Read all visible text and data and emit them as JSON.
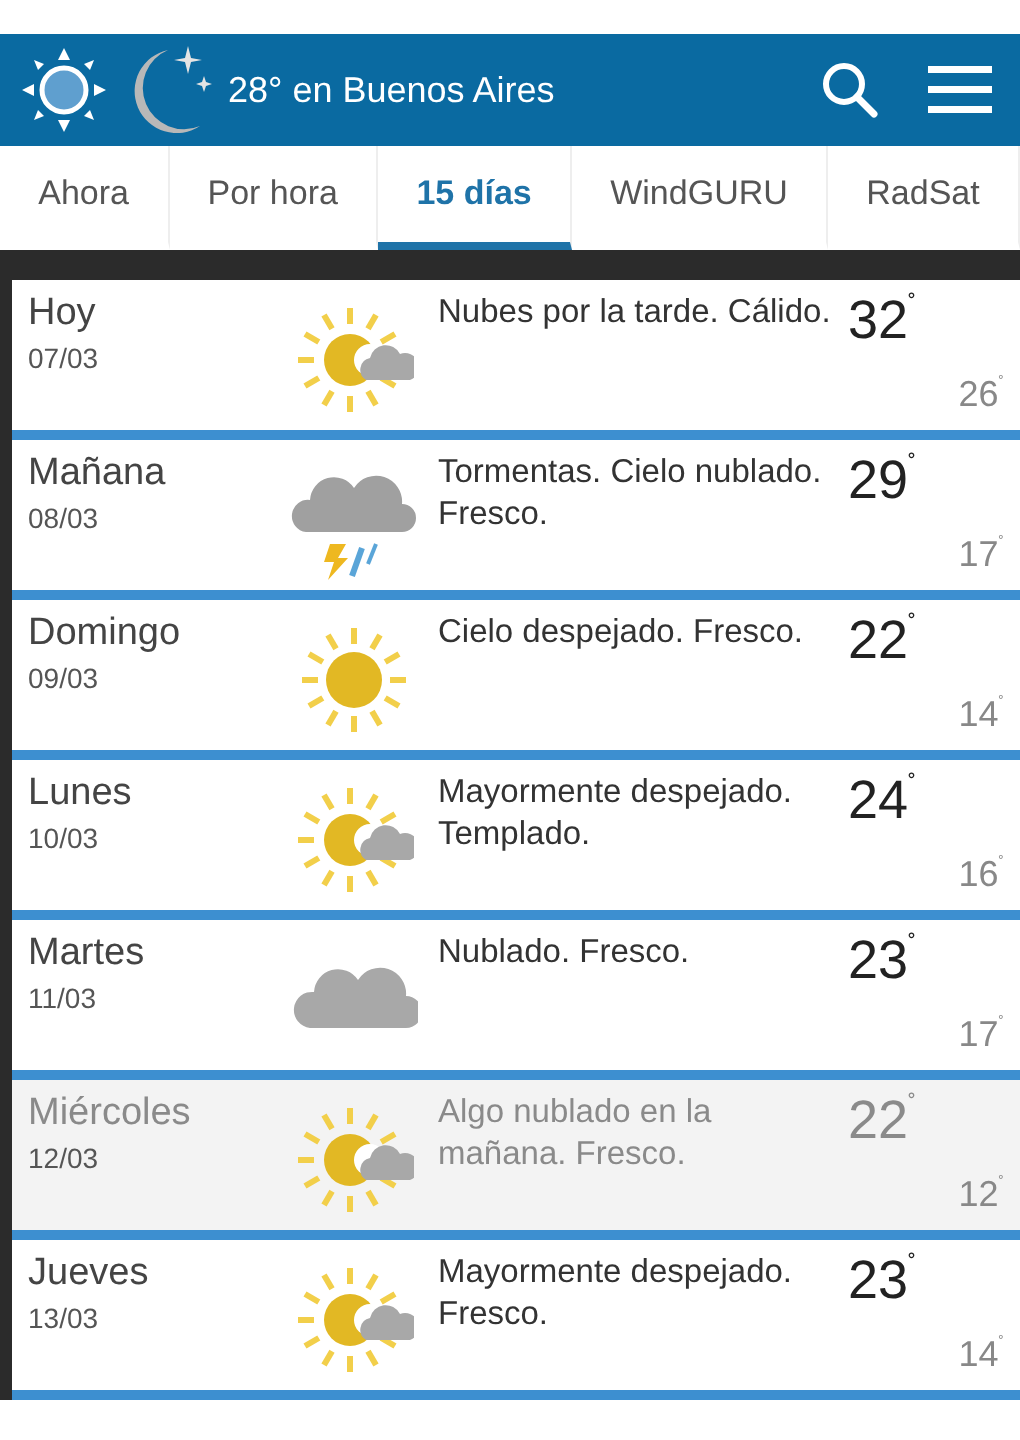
{
  "header": {
    "title": "28° en Buenos Aires"
  },
  "tabs": [
    {
      "label": "Ahora",
      "selected": false
    },
    {
      "label": "Por hora",
      "selected": false
    },
    {
      "label": "15 días",
      "selected": true
    },
    {
      "label": "WindGURU",
      "selected": false
    },
    {
      "label": "RadSat",
      "selected": false
    }
  ],
  "days": [
    {
      "day": "Hoy",
      "date": "07/03",
      "kind": "sun-cloud",
      "description": "Nubes por la tarde. Cálido.",
      "high": "32$^{˚}$",
      "low": "26$^{˚}$",
      "dimmed": false
    },
    {
      "day": "Mañana",
      "date": "08/03",
      "kind": "storm",
      "description": "Tormentas. Cielo nublado. Fresco.",
      "high": "29$^{˚}$",
      "low": "17$^{˚}$",
      "dimmed": false
    },
    {
      "day": "Domingo",
      "date": "09/03",
      "kind": "sun",
      "description": "Cielo despejado. Fresco.",
      "high": "22$^{˚}$",
      "low": "14$^{˚}$",
      "dimmed": false
    },
    {
      "day": "Lunes",
      "date": "10/03",
      "kind": "sun-cloud",
      "description": "Mayormente despejado. Templado.",
      "high": "24$^{˚}$",
      "low": "16$^{˚}$",
      "dimmed": false
    },
    {
      "day": "Martes",
      "date": "11/03",
      "kind": "cloud",
      "description": "Nublado. Fresco.",
      "high": "23$^{˚}$",
      "low": "17$^{˚}$",
      "dimmed": false
    },
    {
      "day": "Miércoles",
      "date": "12/03",
      "kind": "sun-cloud",
      "description": "Algo nublado en la mañana. Fresco.",
      "high": "22$^{˚}$",
      "low": "12$^{˚}$",
      "dimmed": true
    },
    {
      "day": "Jueves",
      "date": "13/03",
      "kind": "sun-cloud",
      "description": "Mayormente despejado. Fresco.",
      "high": "23$^{˚}$",
      "low": "14$^{˚}$",
      "dimmed": false
    }
  ]
}
